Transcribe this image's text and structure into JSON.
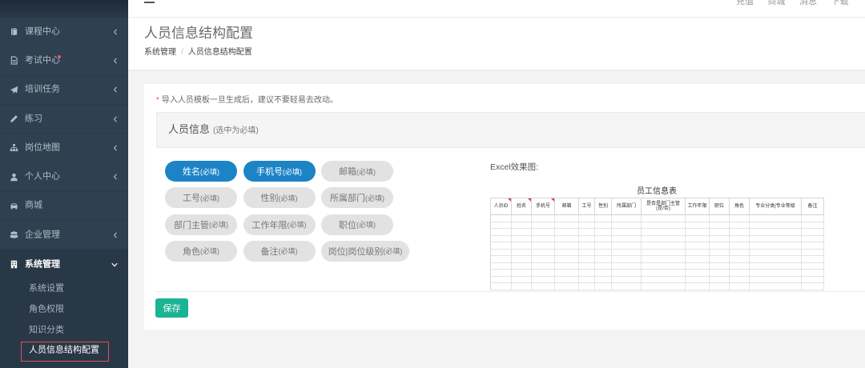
{
  "sidebar": {
    "items": [
      {
        "label": "课程中心",
        "icon": "book-icon",
        "expandable": true
      },
      {
        "label": "考试中心",
        "icon": "file-icon",
        "expandable": true,
        "has_badge_dot": true
      },
      {
        "label": "培训任务",
        "icon": "paper-plane-icon",
        "expandable": true
      },
      {
        "label": "练习",
        "icon": "pencil-icon",
        "expandable": true
      },
      {
        "label": "岗位地图",
        "icon": "sitemap-icon",
        "expandable": true
      },
      {
        "label": "个人中心",
        "icon": "user-icon",
        "expandable": true
      },
      {
        "label": "商城",
        "icon": "car-icon",
        "expandable": false
      },
      {
        "label": "企业管理",
        "icon": "users-icon",
        "expandable": true
      }
    ],
    "active_section": {
      "label": "系统管理",
      "icon": "building-icon",
      "expanded": true,
      "subitems": [
        "系统设置",
        "角色权限",
        "知识分类",
        "人员信息结构配置"
      ],
      "current_index": 3
    }
  },
  "topbar": {
    "menu_icon": "hamburger-icon",
    "links": [
      "充值",
      "商城",
      "消息",
      "下载"
    ]
  },
  "page": {
    "title": "人员信息结构配置",
    "breadcrumb": [
      "系统管理",
      "人员信息结构配置"
    ],
    "breadcrumb_separator": "/"
  },
  "form": {
    "note_marker": "*",
    "note": "导入人员模板一旦生成后，建议不要轻易去改动。",
    "section_title": "人员信息",
    "section_hint": "(选中为必填)",
    "fields": [
      {
        "name": "姓名",
        "hint": "(必填)",
        "selected": true
      },
      {
        "name": "手机号",
        "hint": "(必填)",
        "selected": true
      },
      {
        "name": "邮箱",
        "hint": "(必填)",
        "selected": false
      },
      {
        "name": "工号",
        "hint": "(必填)",
        "selected": false
      },
      {
        "name": "性别",
        "hint": "(必填)",
        "selected": false
      },
      {
        "name": "所属部门",
        "hint": "(必填)",
        "selected": false
      },
      {
        "name": "部门主管",
        "hint": "(必填)",
        "selected": false
      },
      {
        "name": "工作年限",
        "hint": "(必填)",
        "selected": false
      },
      {
        "name": "职位",
        "hint": "(必填)",
        "selected": false
      },
      {
        "name": "角色",
        "hint": "(必填)",
        "selected": false
      },
      {
        "name": "备注",
        "hint": "(必填)",
        "selected": false
      },
      {
        "name": "岗位|岗位级别",
        "hint": "(必填)",
        "selected": false
      }
    ],
    "preview_label": "Excel效果图:",
    "save_label": "保存"
  },
  "excel": {
    "title": "员工信息表",
    "columns": [
      {
        "text": [
          "人员ID"
        ],
        "marked": true
      },
      {
        "text": [
          "姓名"
        ],
        "marked": true
      },
      {
        "text": [
          "手机号"
        ],
        "marked": true
      },
      {
        "text": [
          "邮箱"
        ],
        "marked": false
      },
      {
        "text": [
          "工号"
        ],
        "marked": false
      },
      {
        "text": [
          "性别"
        ],
        "marked": false
      },
      {
        "text": [
          "所属部门"
        ],
        "marked": false
      },
      {
        "text": [
          "是否是部门主管",
          "(是/否)"
        ],
        "marked": false
      },
      {
        "text": [
          "工作年限"
        ],
        "marked": false
      },
      {
        "text": [
          "职位"
        ],
        "marked": false
      },
      {
        "text": [
          "角色"
        ],
        "marked": false
      },
      {
        "text": [
          "专业分类|专业等级"
        ],
        "marked": false
      },
      {
        "text": [
          "备注"
        ],
        "marked": false
      }
    ]
  },
  "colors": {
    "sidebar_bg": "#2f4050",
    "sidebar_active_bg": "#293846",
    "primary": "#1c84c6",
    "success": "#1ab394",
    "danger": "#ed5565",
    "annotation": "#d9534f"
  }
}
